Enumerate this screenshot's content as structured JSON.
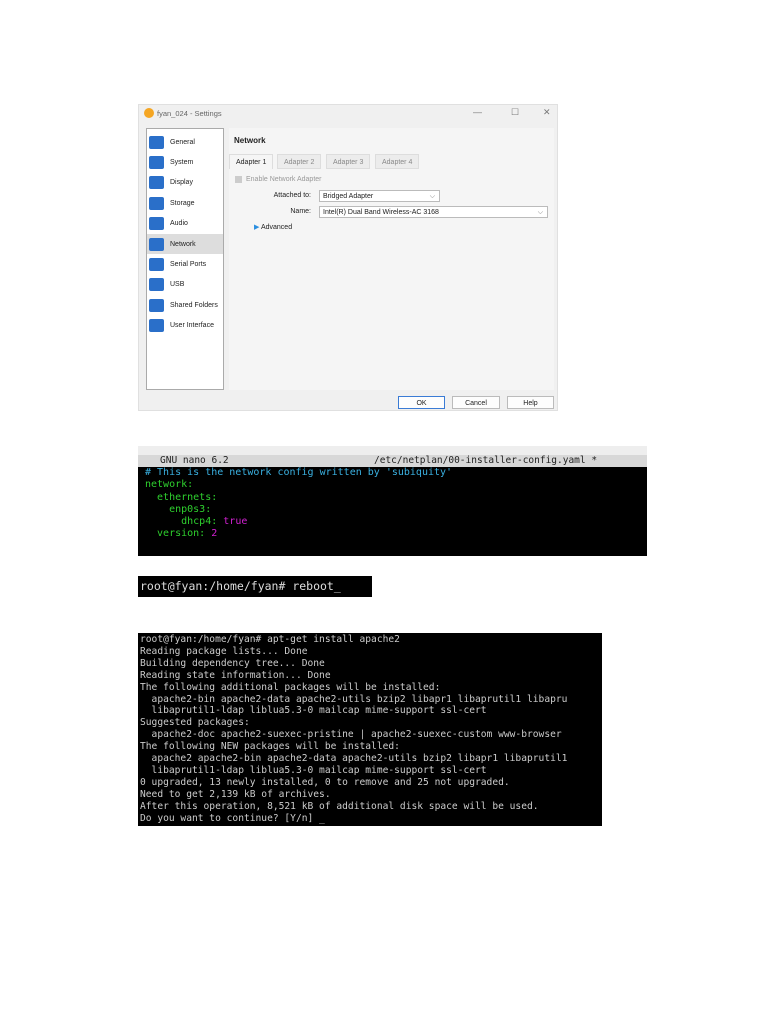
{
  "settings": {
    "title": "fyan_024 - Settings",
    "controls": {
      "minimize": "—",
      "maximize": "☐",
      "close": "✕"
    },
    "sidebar": [
      "General",
      "System",
      "Display",
      "Storage",
      "Audio",
      "Network",
      "Serial Ports",
      "USB",
      "Shared Folders",
      "User Interface"
    ],
    "selected": "Network",
    "heading": "Network",
    "tabs": [
      "Adapter 1",
      "Adapter 2",
      "Adapter 3",
      "Adapter 4"
    ],
    "enable_label": "Enable Network Adapter",
    "attached_label": "Attached to:",
    "attached_value": "Bridged Adapter",
    "name_label": "Name:",
    "name_value": "Intel(R) Dual Band Wireless-AC 3168",
    "advanced": "Advanced",
    "buttons": {
      "ok": "OK",
      "cancel": "Cancel",
      "help": "Help"
    }
  },
  "nano": {
    "header_left": "GNU nano 6.2",
    "header_right": "/etc/netplan/00-installer-config.yaml *",
    "comment": "# This is the network config written by 'subiquity'",
    "l1": "network:",
    "l2": "  ethernets:",
    "l3": "    enp0s3:",
    "l4": "      dhcp4: ",
    "l4v": "true",
    "l5": "  version: ",
    "l5v": "2"
  },
  "reboot": "root@fyan:/home/fyan# reboot_",
  "apt": [
    "root@fyan:/home/fyan# apt-get install apache2",
    "Reading package lists... Done",
    "Building dependency tree... Done",
    "Reading state information... Done",
    "The following additional packages will be installed:",
    "  apache2-bin apache2-data apache2-utils bzip2 libapr1 libaprutil1 libapru",
    "  libaprutil1-ldap liblua5.3-0 mailcap mime-support ssl-cert",
    "Suggested packages:",
    "  apache2-doc apache2-suexec-pristine | apache2-suexec-custom www-browser",
    "The following NEW packages will be installed:",
    "  apache2 apache2-bin apache2-data apache2-utils bzip2 libapr1 libaprutil1",
    "  libaprutil1-ldap liblua5.3-0 mailcap mime-support ssl-cert",
    "0 upgraded, 13 newly installed, 0 to remove and 25 not upgraded.",
    "Need to get 2,139 kB of archives.",
    "After this operation, 8,521 kB of additional disk space will be used.",
    "Do you want to continue? [Y/n] _"
  ]
}
